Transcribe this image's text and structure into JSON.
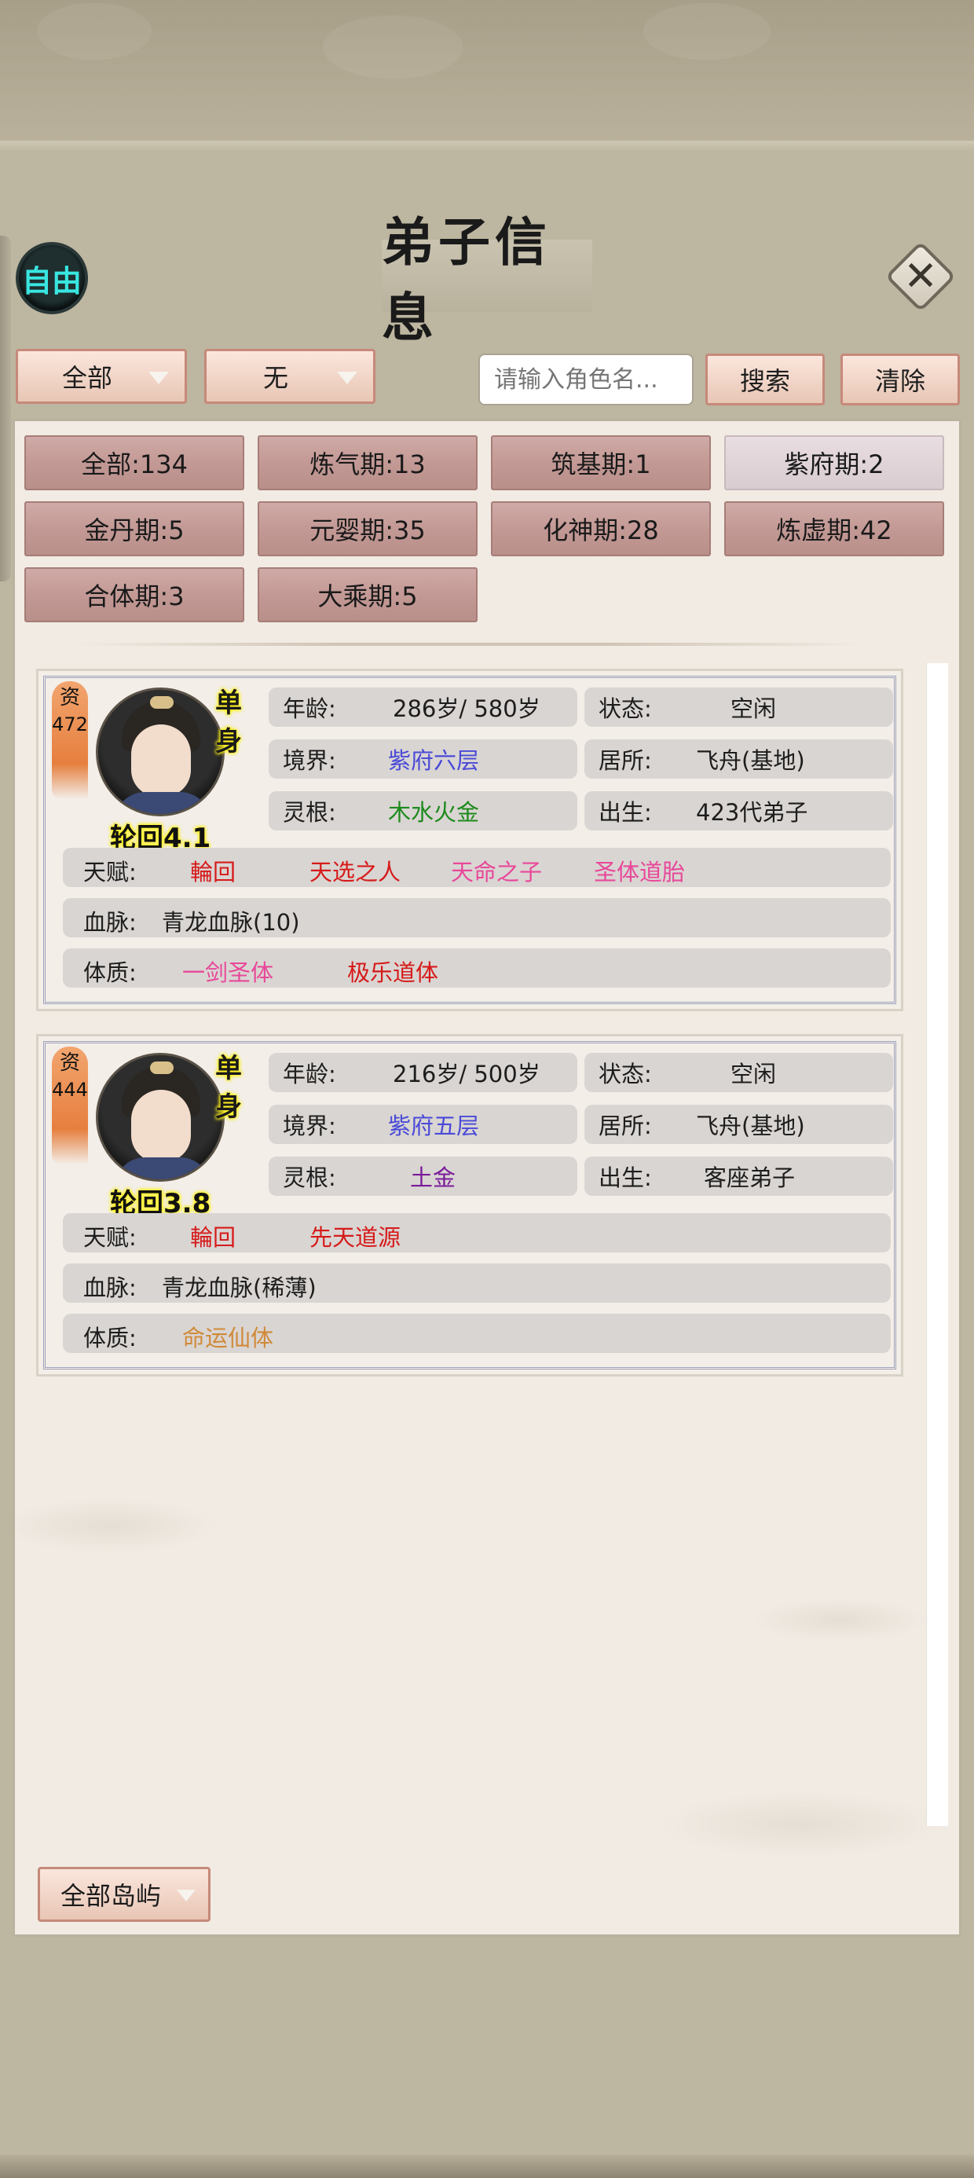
{
  "header": {
    "free_badge": "自由",
    "title": "弟子信息",
    "close_icon": "close-icon"
  },
  "toolbar": {
    "filter_all": "全部",
    "filter_none": "无",
    "search_placeholder": "请输入角色名...",
    "search_label": "搜索",
    "clear_label": "清除"
  },
  "realm_filters": [
    {
      "label": "全部:134",
      "active": false
    },
    {
      "label": "炼气期:13",
      "active": false
    },
    {
      "label": "筑基期:1",
      "active": false
    },
    {
      "label": "紫府期:2",
      "active": true
    },
    {
      "label": "金丹期:5",
      "active": false
    },
    {
      "label": "元婴期:35",
      "active": false
    },
    {
      "label": "化神期:28",
      "active": false
    },
    {
      "label": "炼虚期:42",
      "active": false
    },
    {
      "label": "合体期:3",
      "active": false
    },
    {
      "label": "大乘期:5",
      "active": false
    }
  ],
  "labels": {
    "age": "年龄:",
    "status": "状态:",
    "realm": "境界:",
    "residence": "居所:",
    "root": "灵根:",
    "origin": "出生:",
    "talent": "天赋:",
    "bloodline": "血脉:",
    "physique": "体质:",
    "aptitude": "资"
  },
  "colors": {
    "realm_blue": "#4a4ad8",
    "root_green": "#1e8a1e",
    "root_purple": "#7a1a9a",
    "red": "#d61a1a",
    "pink": "#e8489a",
    "orange": "#d18a3a"
  },
  "disciples": [
    {
      "aptitude": "472",
      "marital": "单身",
      "reincarnation": "轮回4.1",
      "age": "286岁/ 580岁",
      "status": "空闲",
      "realm": "紫府六层",
      "residence": "飞舟(基地)",
      "root": "木水火金",
      "origin": "423代弟子",
      "talents": [
        "輪回",
        "天选之人",
        "天命之子",
        "圣体道胎"
      ],
      "bloodline": "青龙血脉(10)",
      "physiques": [
        "一剑圣体",
        "极乐道体"
      ]
    },
    {
      "aptitude": "444",
      "marital": "单身",
      "reincarnation": "轮回3.8",
      "age": "216岁/ 500岁",
      "status": "空闲",
      "realm": "紫府五层",
      "residence": "飞舟(基地)",
      "root": "土金",
      "origin": "客座弟子",
      "talents": [
        "輪回",
        "先天道源"
      ],
      "bloodline": "青龙血脉(稀薄)",
      "physiques": [
        "命运仙体"
      ]
    }
  ],
  "footer": {
    "island_filter": "全部岛屿"
  }
}
